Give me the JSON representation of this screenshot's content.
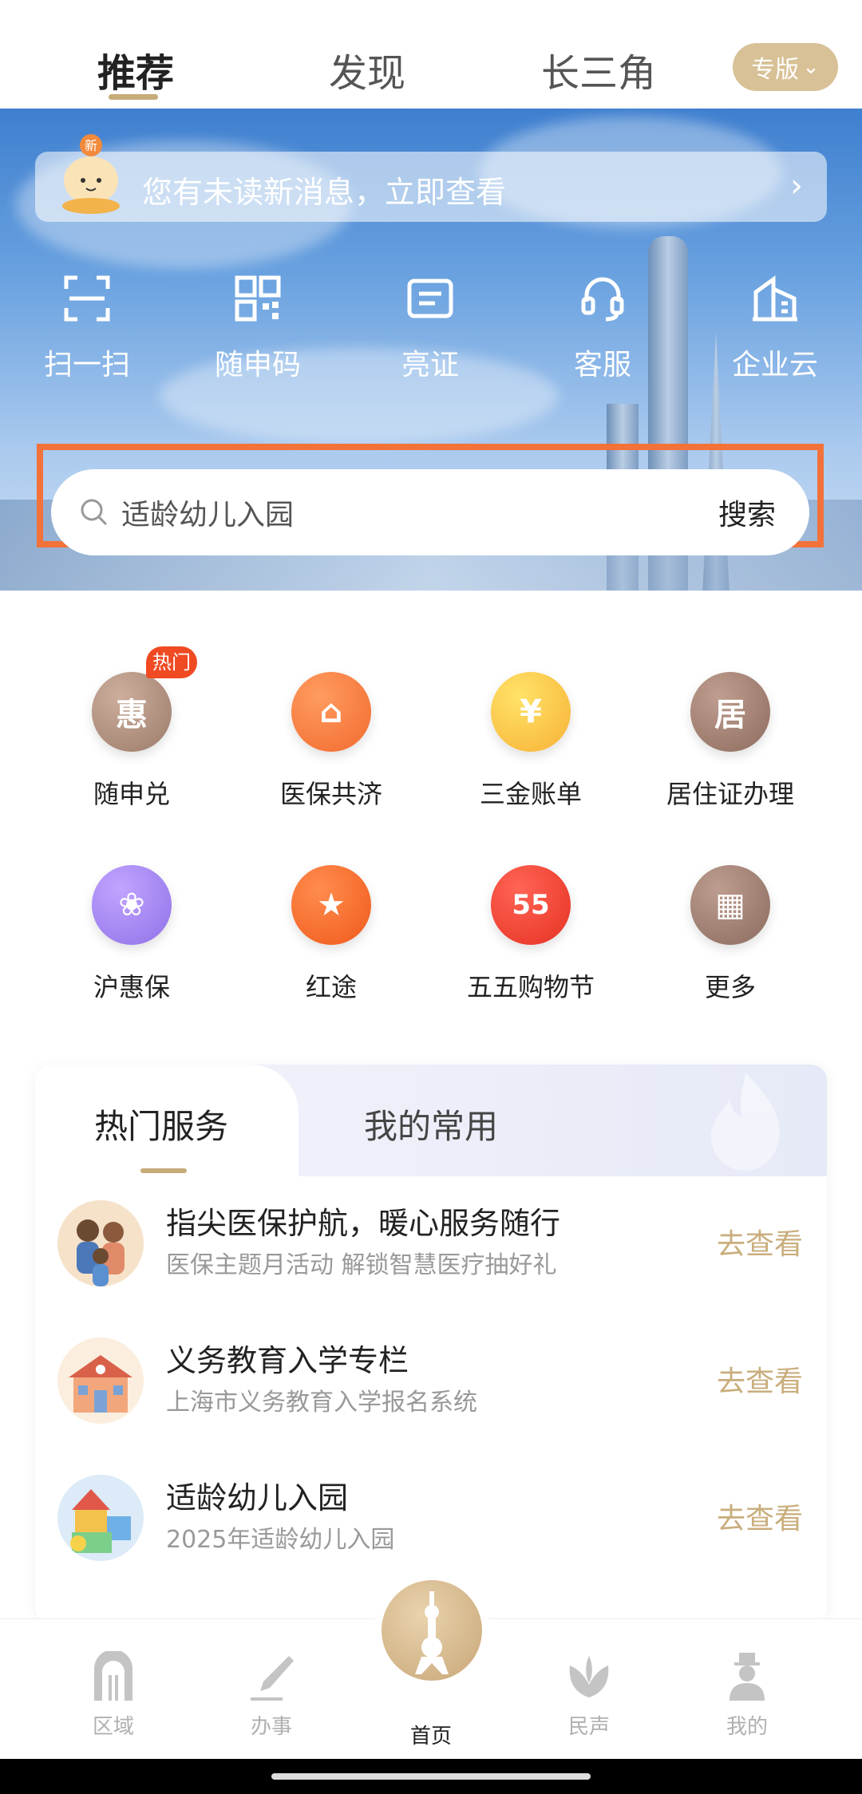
{
  "top_tabs": [
    {
      "label": "推荐"
    },
    {
      "label": "发现"
    },
    {
      "label": "长三角"
    }
  ],
  "edition": {
    "label": "专版",
    "chevron": "⌄"
  },
  "message_banner": {
    "text": "您有未读新消息，立即查看",
    "arrow": "›",
    "mascot_badge": "新"
  },
  "quick_actions": [
    {
      "label": "扫一扫",
      "icon": "scan-icon"
    },
    {
      "label": "随申码",
      "icon": "qr-code-icon"
    },
    {
      "label": "亮证",
      "icon": "card-icon"
    },
    {
      "label": "客服",
      "icon": "headset-icon"
    },
    {
      "label": "企业云",
      "icon": "building-icon"
    }
  ],
  "search": {
    "placeholder": "适龄幼儿入园",
    "button": "搜索"
  },
  "services": [
    {
      "label": "随申兑",
      "badge": "热门",
      "color": "#9b7b6a",
      "glyph": "惠"
    },
    {
      "label": "医保共济",
      "color": "#f26a2e",
      "glyph": "⌂"
    },
    {
      "label": "三金账单",
      "color": "#f7b136",
      "glyph": "¥"
    },
    {
      "label": "居住证办理",
      "color": "#8d6c5e",
      "glyph": "居"
    },
    {
      "label": "沪惠保",
      "color": "#8f72e8",
      "glyph": "❀"
    },
    {
      "label": "红途",
      "color": "#f05a1c",
      "glyph": "★"
    },
    {
      "label": "五五购物节",
      "color": "#e63223",
      "glyph": "55"
    },
    {
      "label": "更多",
      "color": "#8b6b5d",
      "glyph": "▦"
    }
  ],
  "hot_card": {
    "tabs": [
      {
        "label": "热门服务"
      },
      {
        "label": "我的常用"
      }
    ],
    "rows": [
      {
        "title": "指尖医保护航，暖心服务随行",
        "subtitle": "医保主题月活动 解锁智慧医疗抽好礼",
        "action": "去查看"
      },
      {
        "title": "义务教育入学专栏",
        "subtitle": "上海市义务教育入学报名系统",
        "action": "去查看"
      },
      {
        "title": "适龄幼儿入园",
        "subtitle": "2025年适龄幼儿入园",
        "action": "去查看"
      }
    ]
  },
  "bottom_nav": [
    {
      "label": "区域",
      "icon": "region-icon"
    },
    {
      "label": "办事",
      "icon": "pen-icon"
    },
    {
      "label": "首页",
      "icon": "home-tower-icon"
    },
    {
      "label": "民声",
      "icon": "lotus-icon"
    },
    {
      "label": "我的",
      "icon": "profile-icon"
    }
  ],
  "colors": {
    "accent": "#c7ab78",
    "highlight": "#f2723a",
    "hot": "#f04a22"
  }
}
